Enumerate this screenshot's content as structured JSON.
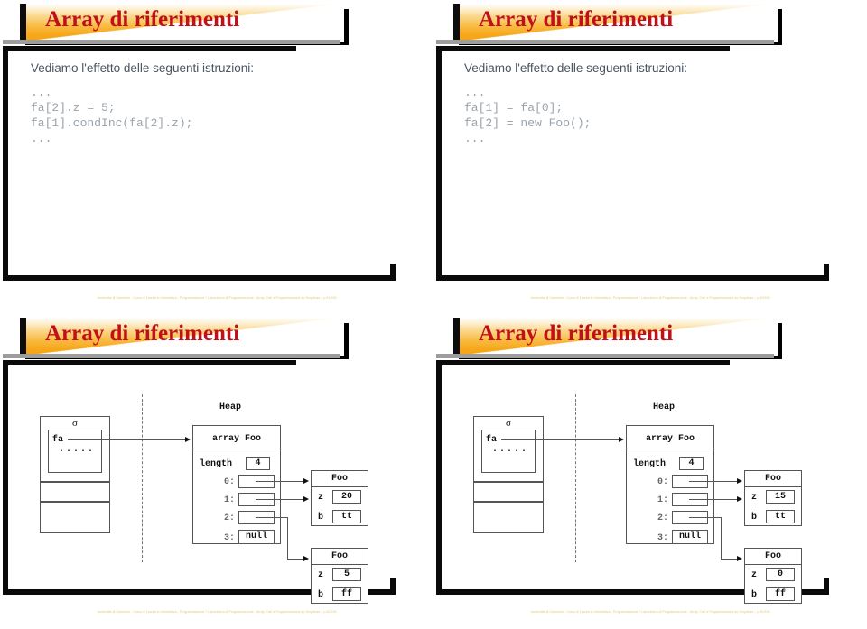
{
  "deck": {
    "title": "Array di riferimenti",
    "footer": "Università di Camerino - Corso di Laurea in Informatica - Programmazione + Laboratorio di Programmazione - Array, Cicli e Programmazione su Sequenze – p.51/105",
    "footer_52": "Università di Camerino - Corso di Laurea in Informatica - Programmazione + Laboratorio di Programmazione - Array, Cicli e Programmazione su Sequenze – p.52/105",
    "footer_49": "Università di Camerino - Corso di Laurea in Informatica - Programmazione + Laboratorio di Programmazione - Array, Cicli e Programmazione su Sequenze – p.49/105",
    "footer_50": "Università di Camerino - Corso di Laurea in Informatica - Programmazione + Laboratorio di Programmazione - Array, Cicli e Programmazione su Sequenze – p.50/105",
    "colors": {
      "title_red": "#c0101a",
      "banner_orange": "#f5a312",
      "grey_rule": "#9d9d9d",
      "frame_black": "#0a0a0a",
      "body_text": "#4a5561",
      "code_text": "#9aa3ab",
      "footer_gold": "#e4c86a"
    }
  },
  "slide_tl": {
    "title": "Array di riferimenti",
    "intro": "Vediamo l'effetto delle seguenti istruzioni:",
    "code": "...\nfa[2].z = 5;\nfa[1].condInc(fa[2].z);\n..."
  },
  "slide_tr": {
    "title": "Array di riferimenti",
    "intro": "Vediamo l'effetto delle seguenti istruzioni:",
    "code": "...\nfa[1] = fa[0];\nfa[2] = new Foo();\n..."
  },
  "slide_bl": {
    "title": "Array di riferimenti",
    "diagram": {
      "stack_label": "σ",
      "stack_var": "fa",
      "stack_dots": ".....",
      "heap_label": "Heap",
      "array_title": "array Foo",
      "length_label": "length",
      "length_value": "4",
      "slots": [
        {
          "index": "0:",
          "value": ""
        },
        {
          "index": "1:",
          "value": ""
        },
        {
          "index": "2:",
          "value": ""
        },
        {
          "index": "3:",
          "value": "null"
        }
      ],
      "objects": [
        {
          "title": "Foo",
          "fields": [
            {
              "name": "z",
              "value": "20"
            },
            {
              "name": "b",
              "value": "tt"
            }
          ]
        },
        {
          "title": "Foo",
          "fields": [
            {
              "name": "z",
              "value": "5"
            },
            {
              "name": "b",
              "value": "ff"
            }
          ]
        }
      ]
    }
  },
  "slide_br": {
    "title": "Array di riferimenti",
    "diagram": {
      "stack_label": "σ",
      "stack_var": "fa",
      "stack_dots": ".....",
      "heap_label": "Heap",
      "array_title": "array Foo",
      "length_label": "length",
      "length_value": "4",
      "slots": [
        {
          "index": "0:",
          "value": ""
        },
        {
          "index": "1:",
          "value": ""
        },
        {
          "index": "2:",
          "value": ""
        },
        {
          "index": "3:",
          "value": "null"
        }
      ],
      "objects": [
        {
          "title": "Foo",
          "fields": [
            {
              "name": "z",
              "value": "15"
            },
            {
              "name": "b",
              "value": "tt"
            }
          ]
        },
        {
          "title": "Foo",
          "fields": [
            {
              "name": "z",
              "value": "0"
            },
            {
              "name": "b",
              "value": "ff"
            }
          ]
        }
      ]
    }
  }
}
